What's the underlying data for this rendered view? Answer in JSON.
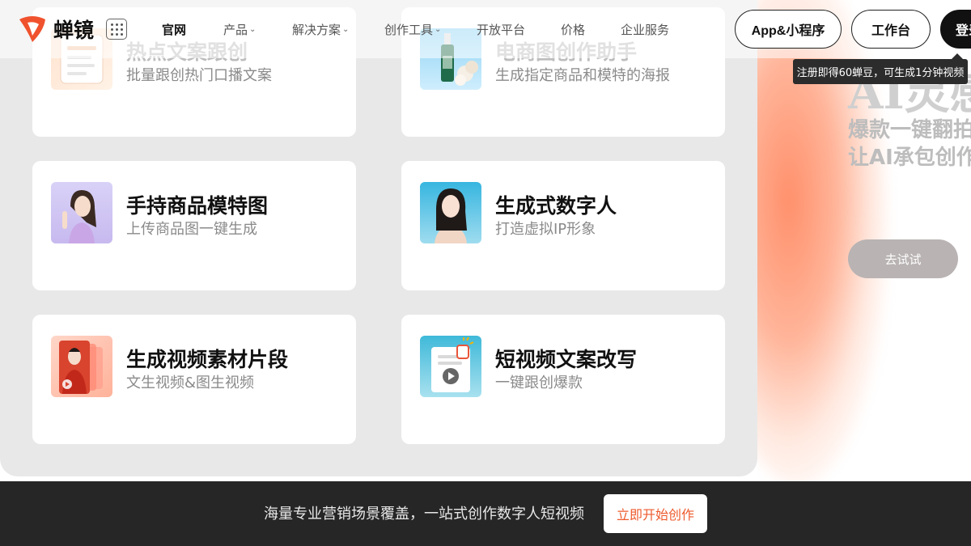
{
  "brand": {
    "name": "蝉镜",
    "accent": "#f0522e"
  },
  "nav": {
    "items": [
      {
        "label": "官网",
        "active": true,
        "dropdown": false
      },
      {
        "label": "产品",
        "active": false,
        "dropdown": true
      },
      {
        "label": "解决方案",
        "active": false,
        "dropdown": true
      },
      {
        "label": "创作工具",
        "active": false,
        "dropdown": true
      },
      {
        "label": "开放平台",
        "active": false,
        "dropdown": false
      },
      {
        "label": "价格",
        "active": false,
        "dropdown": false
      },
      {
        "label": "企业服务",
        "active": false,
        "dropdown": false
      }
    ],
    "chevron": "⌄"
  },
  "header_buttons": {
    "app": "App&小程序",
    "workbench": "工作台",
    "login": "登录"
  },
  "tooltip": "注册即得60蝉豆，可生成1分钟视频",
  "cards": [
    {
      "title": "热点文案跟创",
      "subtitle": "批量跟创热门口播文案",
      "icon": "document-thumbnail"
    },
    {
      "title": "电商图创作助手",
      "subtitle": "生成指定商品和模特的海报",
      "icon": "product-bottle-thumbnail"
    },
    {
      "title": "手持商品模特图",
      "subtitle": "上传商品图一键生成",
      "icon": "model-photo-thumbnail"
    },
    {
      "title": "生成式数字人",
      "subtitle": "打造虚拟IP形象",
      "icon": "digital-human-thumbnail"
    },
    {
      "title": "生成视频素材片段",
      "subtitle": "文生视频&图生视频",
      "icon": "video-clip-thumbnail"
    },
    {
      "title": "短视频文案改写",
      "subtitle": "一键跟创爆款",
      "icon": "rewrite-video-thumbnail"
    }
  ],
  "hero": {
    "big": "AI灵感",
    "line1": "爆款一键翻拍",
    "line2": "让AI承包创作",
    "try_button": "去试试"
  },
  "footer": {
    "text": "海量专业营销场景覆盖，一站式创作数字人短视频",
    "button": "立即开始创作"
  }
}
